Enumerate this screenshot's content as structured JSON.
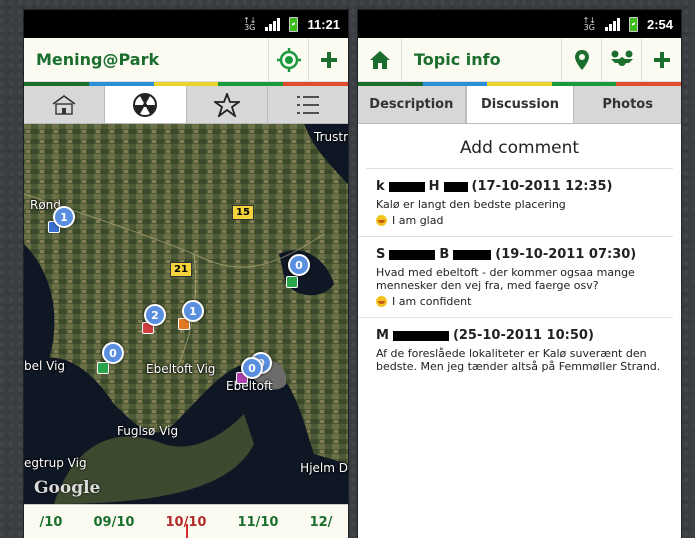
{
  "colors": {
    "app_green": "#1b6e2d",
    "stripe": [
      "#1b6e2d",
      "#2a8fd6",
      "#e8d428",
      "#1b9a3d",
      "#e24b2c"
    ],
    "cluster_blue": "#5a8fe0",
    "timeline_marker": "#d72a2a"
  },
  "left_phone": {
    "status": {
      "network": "3G",
      "time": "11:21"
    },
    "app_bar": {
      "title": "Mening@Park",
      "icons": [
        "location-target-icon",
        "plus-icon"
      ]
    },
    "tabs": [
      "home-icon",
      "radiation-icon",
      "star-icon",
      "list-icon"
    ],
    "active_tab": 1,
    "map": {
      "place_labels": [
        "Trustr",
        "Rønd",
        "bel Vig",
        "Ebeltoft Vig",
        "Ebeltoft",
        "Fuglsø Vig",
        "egtrup Vig",
        "Hjelm D"
      ],
      "road_badges": [
        "15",
        "21"
      ],
      "clusters": [
        "1",
        "0",
        "2",
        "1",
        "0",
        "0",
        "0"
      ],
      "logo": "Google"
    },
    "timeline": {
      "dates": [
        "/10",
        "09/10",
        "10/10",
        "11/10",
        "12/"
      ],
      "selected_index": 2
    }
  },
  "right_phone": {
    "status": {
      "network": "3G",
      "time": "2:54"
    },
    "app_bar": {
      "title": "Topic info",
      "icons": [
        "home-icon",
        "map-pin-icon",
        "people-icon",
        "plus-icon"
      ]
    },
    "tabs": [
      "Description",
      "Discussion",
      "Photos"
    ],
    "active_tab": 1,
    "heading": "Add comment",
    "comments": [
      {
        "author_initial": "k",
        "author_second_initial": "H",
        "timestamp": "(17-10-2011 12:35)",
        "body": "Kalø er langt den bedste placering",
        "mood": "I am glad"
      },
      {
        "author_initial": "S",
        "author_second_initial": "B",
        "timestamp": "(19-10-2011 07:30)",
        "body": "Hvad med ebeltoft - der kommer ogsaa mange mennesker den vej fra, med faerge osv?",
        "mood": "I am confident"
      },
      {
        "author_initial": "M",
        "author_second_initial": "",
        "timestamp": "(25-10-2011 10:50)",
        "body": "Af de foreslåede lokaliteter er Kalø suverænt den bedste. Men jeg tænder altså på Femmøller Strand.",
        "mood": ""
      }
    ]
  }
}
